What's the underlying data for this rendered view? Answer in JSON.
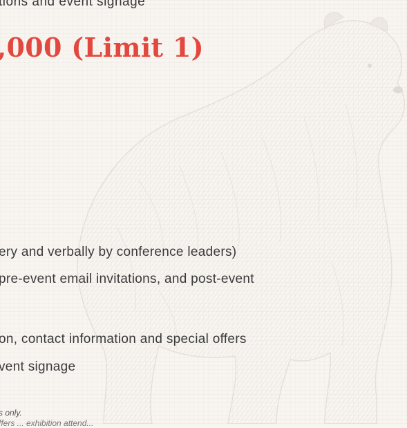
{
  "top_text": "tions and event signage",
  "sponsor_heading": ",000 (Limit 1)",
  "benefits": [
    "ery and verbally by conference leaders)",
    "pre-event email invitations, and post-event",
    "on, contact information and special offers",
    "vent signage"
  ],
  "notes": [
    "s only.",
    "ffers ... exhibition attend..."
  ],
  "colors": {
    "accent": "#e3483f",
    "text": "#3a3a3a",
    "background": "#f8f5f1"
  },
  "decoration": {
    "background_image": "bear-engraving-illustration"
  }
}
